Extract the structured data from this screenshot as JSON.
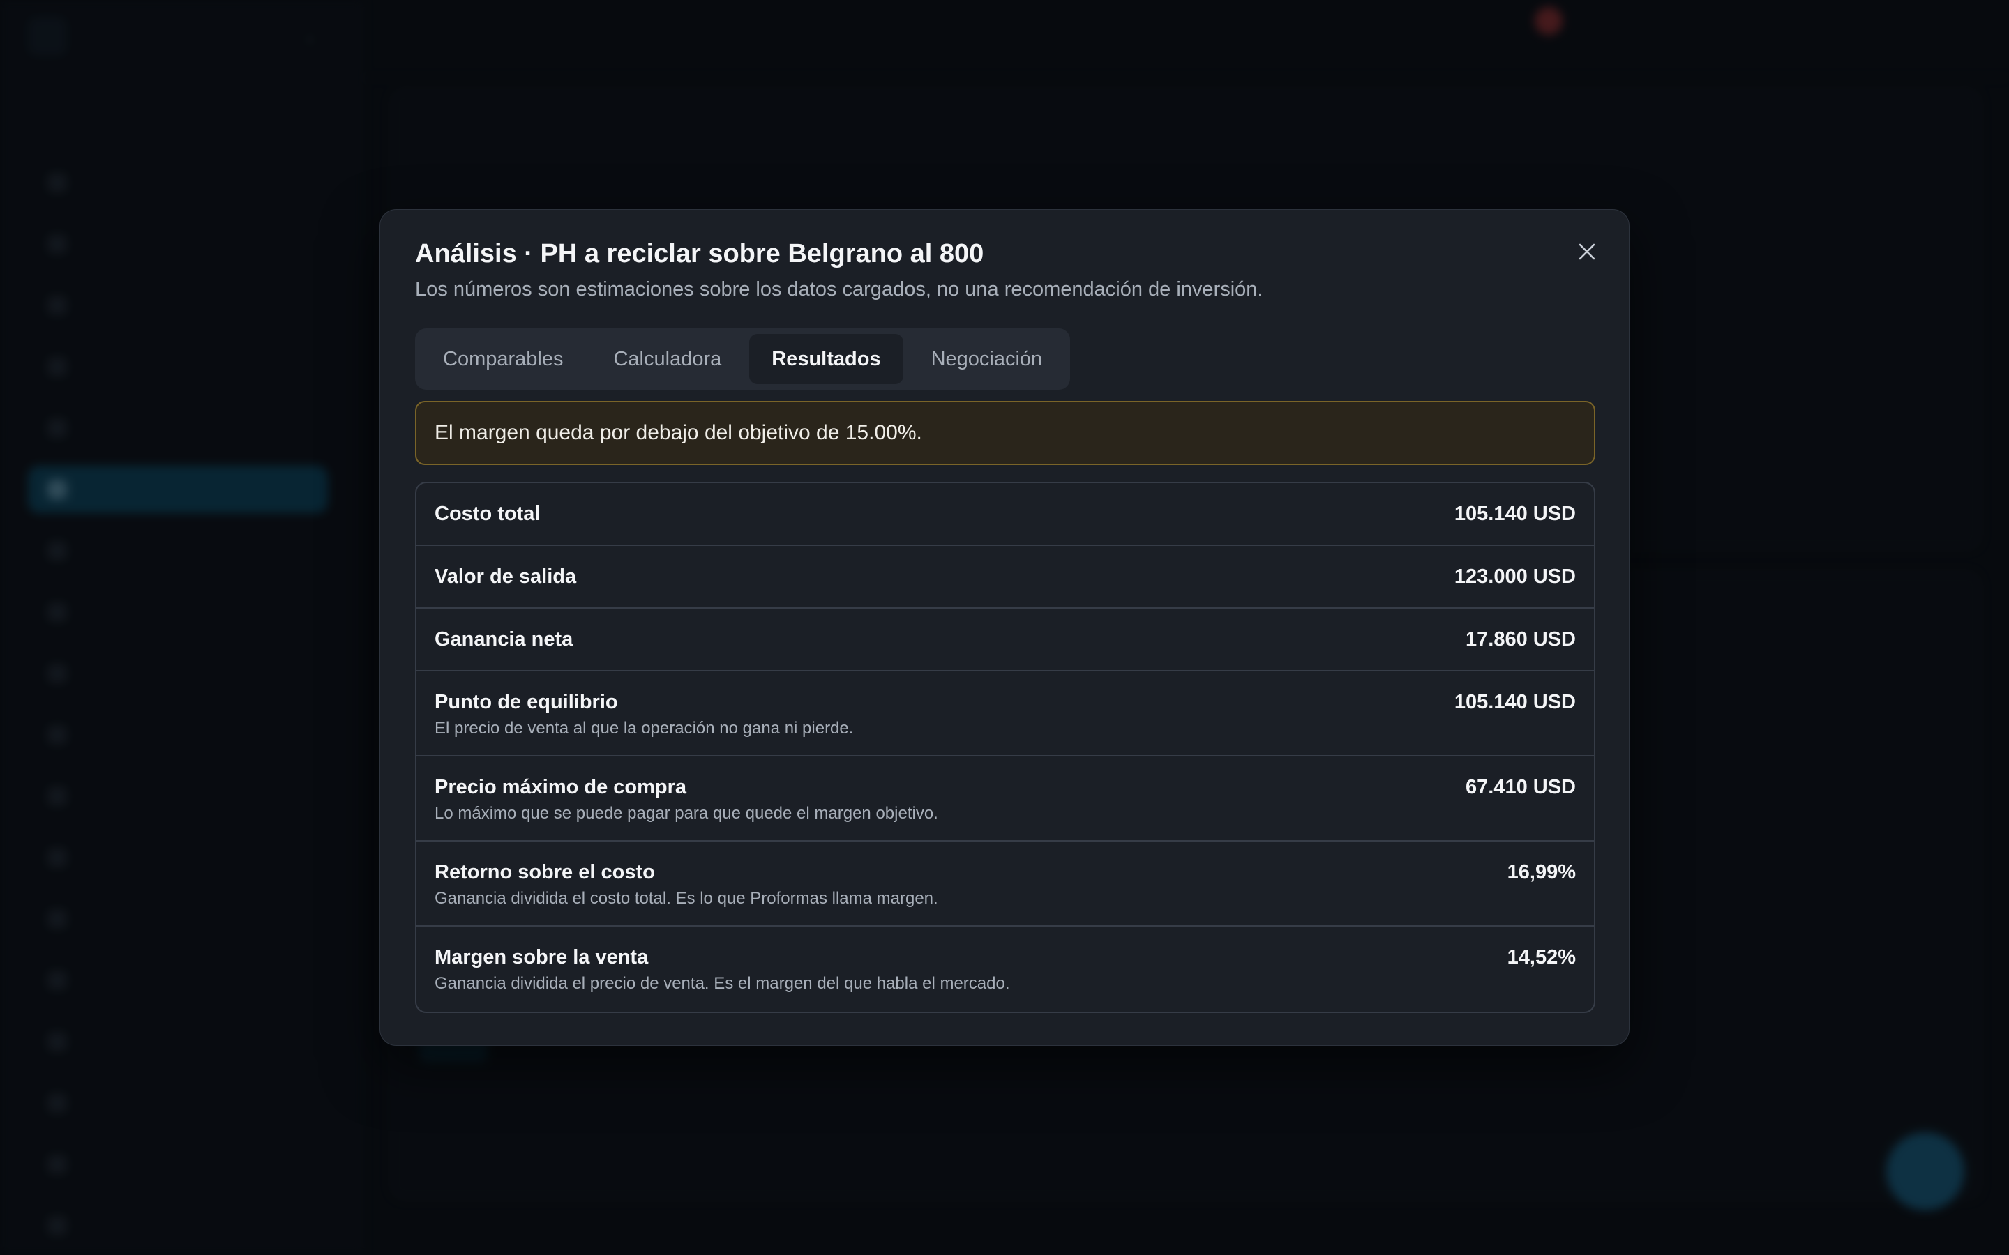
{
  "modal": {
    "title": "Análisis · PH a reciclar sobre Belgrano al 800",
    "subtitle": "Los números son estimaciones sobre los datos cargados, no una recomendación de inversión.",
    "close_icon": "close-icon",
    "tabs": [
      {
        "label": "Comparables",
        "active": false
      },
      {
        "label": "Calculadora",
        "active": false
      },
      {
        "label": "Resultados",
        "active": true
      },
      {
        "label": "Negociación",
        "active": false
      }
    ],
    "alert": "El margen queda por debajo del objetivo de 15.00%.",
    "results": [
      {
        "label": "Costo total",
        "value": "105.140 USD"
      },
      {
        "label": "Valor de salida",
        "value": "123.000 USD"
      },
      {
        "label": "Ganancia neta",
        "value": "17.860 USD"
      },
      {
        "label": "Punto de equilibrio",
        "desc": "El precio de venta al que la operación no gana ni pierde.",
        "value": "105.140 USD"
      },
      {
        "label": "Precio máximo de compra",
        "desc": "Lo máximo que se puede pagar para que quede el margen objetivo.",
        "value": "67.410 USD"
      },
      {
        "label": "Retorno sobre el costo",
        "desc": "Ganancia dividida el costo total. Es lo que Proformas llama margen.",
        "value": "16,99%"
      },
      {
        "label": "Margen sobre la venta",
        "desc": "Ganancia dividida el precio de venta. Es el margen del que habla el mercado.",
        "value": "14,52%"
      }
    ]
  },
  "colors": {
    "modal_bg": "#1b1f26",
    "alert_border": "#7a6428",
    "alert_bg": "#2a251b",
    "active_nav": "#0f5a7a",
    "fab": "#1d7aa6"
  }
}
